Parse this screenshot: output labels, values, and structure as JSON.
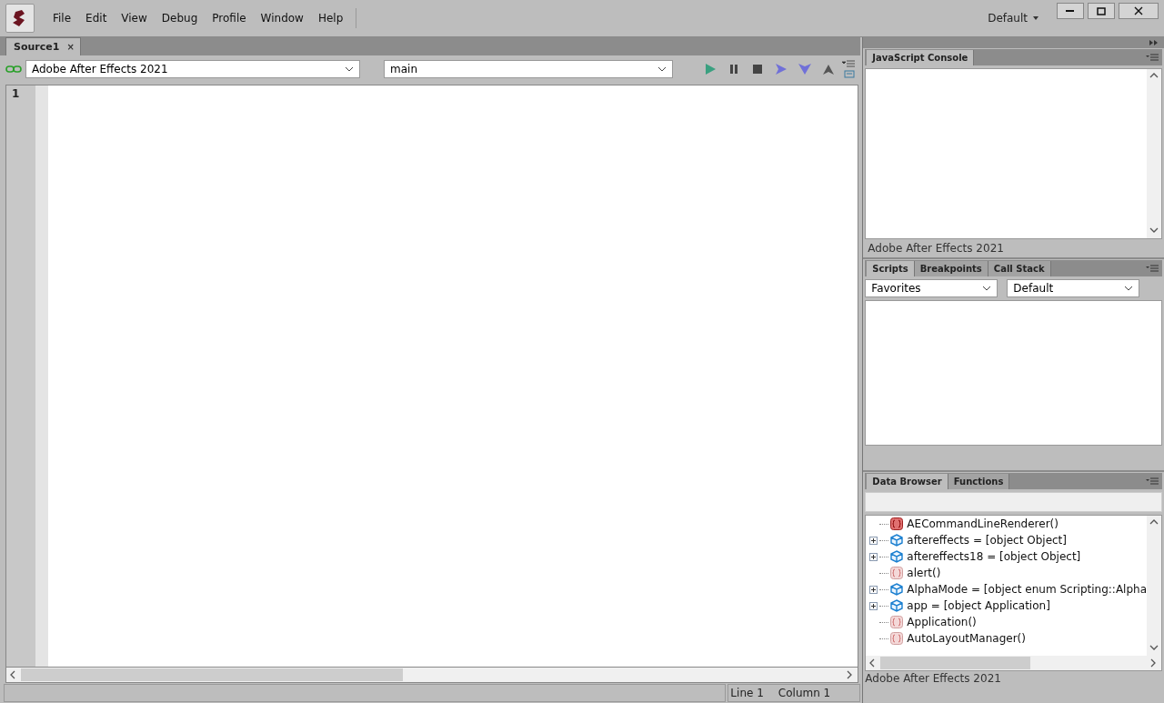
{
  "menu": [
    "File",
    "Edit",
    "View",
    "Debug",
    "Profile",
    "Window",
    "Help"
  ],
  "workspace": "Default",
  "document_tabs": [
    {
      "label": "Source1",
      "selected": true,
      "close": "×"
    }
  ],
  "toolbar": {
    "target": "Adobe After Effects 2021",
    "engine": "main",
    "connected": true
  },
  "editor": {
    "line_numbers": [
      "1"
    ]
  },
  "console": {
    "tabs": [
      {
        "label": "JavaScript Console",
        "selected": true
      }
    ],
    "target": "Adobe After Effects 2021"
  },
  "scripts": {
    "tabs": [
      {
        "label": "Scripts",
        "selected": true
      },
      {
        "label": "Breakpoints",
        "selected": false
      },
      {
        "label": "Call Stack",
        "selected": false
      }
    ],
    "filter": "Favorites",
    "group": "Default"
  },
  "data_browser": {
    "tabs": [
      {
        "label": "Data Browser",
        "selected": true
      },
      {
        "label": "Functions",
        "selected": false
      }
    ],
    "items": [
      {
        "label": "AECommandLineRenderer()",
        "kind": "constructor",
        "expandable": false
      },
      {
        "label": "aftereffects = [object Object]",
        "kind": "object",
        "expandable": true
      },
      {
        "label": "aftereffects18 = [object Object]",
        "kind": "object",
        "expandable": true
      },
      {
        "label": "alert()",
        "kind": "function",
        "expandable": false
      },
      {
        "label": "AlphaMode = [object enum Scripting::Alpha",
        "kind": "object",
        "expandable": true
      },
      {
        "label": "app = [object Application]",
        "kind": "object",
        "expandable": true
      },
      {
        "label": "Application()",
        "kind": "function",
        "expandable": false
      },
      {
        "label": "AutoLayoutManager()",
        "kind": "function",
        "expandable": false
      }
    ],
    "target": "Adobe After Effects 2021"
  },
  "status_bar": {
    "line": "Line 1",
    "column": "Column 1"
  }
}
